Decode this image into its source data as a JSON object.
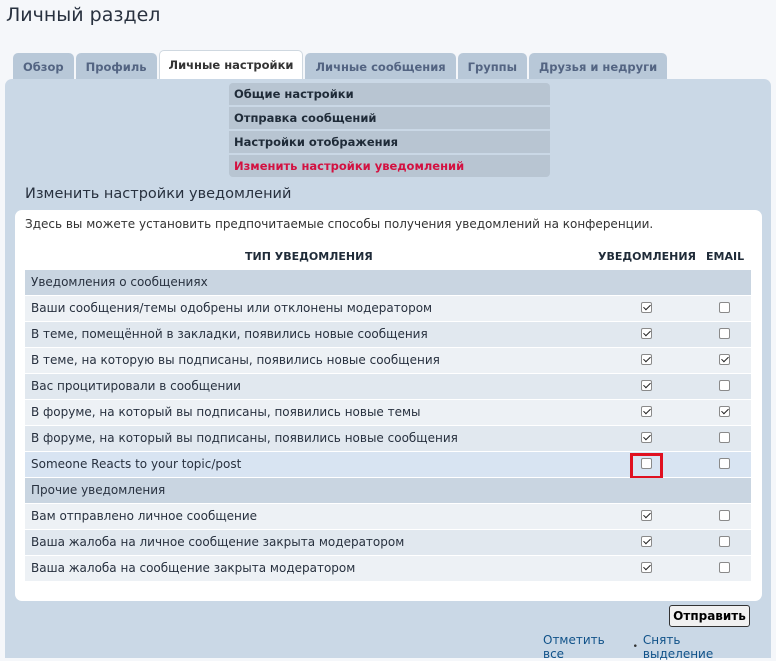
{
  "page_title": "Личный раздел",
  "tabs": [
    {
      "label": "Обзор",
      "active": false
    },
    {
      "label": "Профиль",
      "active": false
    },
    {
      "label": "Личные настройки",
      "active": true
    },
    {
      "label": "Личные сообщения",
      "active": false
    },
    {
      "label": "Группы",
      "active": false
    },
    {
      "label": "Друзья и недруги",
      "active": false
    }
  ],
  "subnav": [
    {
      "label": "Общие настройки",
      "current": false
    },
    {
      "label": "Отправка сообщений",
      "current": false
    },
    {
      "label": "Настройки отображения",
      "current": false
    },
    {
      "label": "Изменить настройки уведомлений",
      "current": true
    }
  ],
  "section_title": "Изменить настройки уведомлений",
  "intro": "Здесь вы можете установить предпочитаемые способы получения уведомлений на конференции.",
  "table": {
    "header": {
      "type": "ТИП УВЕДОМЛЕНИЯ",
      "notifications": "УВЕДОМЛЕНИЯ",
      "email": "EMAIL"
    },
    "categories": [
      {
        "label": "Уведомления о сообщениях",
        "rows": [
          {
            "label": "Ваши сообщения/темы одобрены или отклонены модератором",
            "notif": true,
            "email": false
          },
          {
            "label": "В теме, помещённой в закладки, появились новые сообщения",
            "notif": true,
            "email": false
          },
          {
            "label": "В теме, на которую вы подписаны, появились новые сообщения",
            "notif": true,
            "email": true
          },
          {
            "label": "Вас процитировали в сообщении",
            "notif": true,
            "email": false
          },
          {
            "label": "В форуме, на который вы подписаны, появились новые темы",
            "notif": true,
            "email": true
          },
          {
            "label": "В форуме, на который вы подписаны, появились новые сообщения",
            "notif": true,
            "email": false
          },
          {
            "label": "Someone Reacts to your topic/post",
            "notif": false,
            "email": false,
            "highlight": true
          }
        ]
      },
      {
        "label": "Прочие уведомления",
        "rows": [
          {
            "label": "Вам отправлено личное сообщение",
            "notif": true,
            "email": false
          },
          {
            "label": "Ваша жалоба на личное сообщение закрыта модератором",
            "notif": true,
            "email": false
          },
          {
            "label": "Ваша жалоба на сообщение закрыта модератором",
            "notif": true,
            "email": false
          }
        ]
      }
    ]
  },
  "submit_label": "Отправить",
  "mark_all": "Отметить все",
  "separator": "•",
  "unmark_all": "Снять выделение"
}
